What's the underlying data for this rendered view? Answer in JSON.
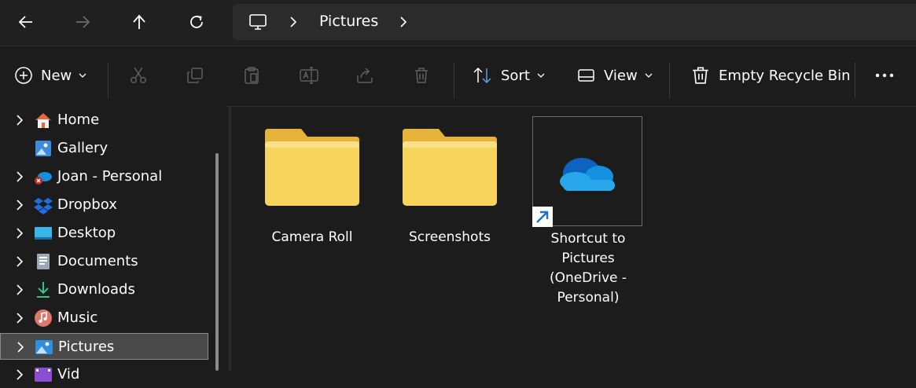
{
  "nav": {
    "breadcrumb": [
      "Pictures"
    ]
  },
  "toolbar": {
    "new_label": "New",
    "sort_label": "Sort",
    "view_label": "View",
    "empty_recycle_label": "Empty Recycle Bin"
  },
  "sidebar": {
    "items": [
      {
        "label": "Home",
        "icon": "home-icon",
        "expandable": true
      },
      {
        "label": "Gallery",
        "icon": "gallery-icon",
        "expandable": false
      },
      {
        "label": "Joan - Personal",
        "icon": "onedrive-error-icon",
        "expandable": true
      },
      {
        "label": "Dropbox",
        "icon": "dropbox-icon",
        "expandable": true
      },
      {
        "label": "Desktop",
        "icon": "desktop-icon",
        "expandable": true
      },
      {
        "label": "Documents",
        "icon": "documents-icon",
        "expandable": true
      },
      {
        "label": "Downloads",
        "icon": "downloads-icon",
        "expandable": true
      },
      {
        "label": "Music",
        "icon": "music-icon",
        "expandable": true
      },
      {
        "label": "Pictures",
        "icon": "pictures-icon",
        "expandable": true,
        "selected": true
      },
      {
        "label": "Vid",
        "icon": "videos-icon",
        "expandable": true
      }
    ]
  },
  "content": {
    "items": [
      {
        "name": "Camera Roll",
        "type": "folder"
      },
      {
        "name": "Screenshots",
        "type": "folder"
      },
      {
        "name_lines": [
          "Shortcut to",
          "Pictures",
          "(OneDrive -",
          "Personal)"
        ],
        "type": "shortcut"
      }
    ]
  },
  "colors": {
    "background": "#1c1c1c",
    "address_bar": "#2b2b2b",
    "selection": "#4a4a4a",
    "folder_yellow": "#f9d45c",
    "onedrive_blue": "#0f78d4"
  }
}
